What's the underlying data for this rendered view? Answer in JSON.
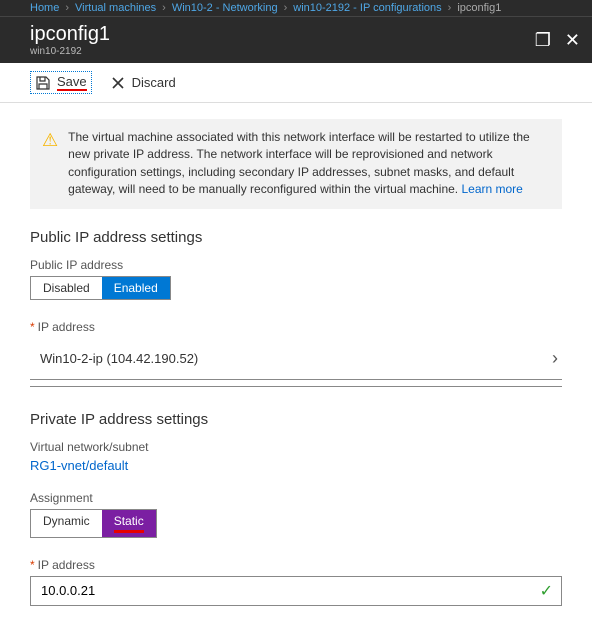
{
  "breadcrumb": {
    "items": [
      "Home",
      "Virtual machines",
      "Win10-2 - Networking",
      "win10-2192 - IP configurations"
    ],
    "current": "ipconfig1"
  },
  "header": {
    "title": "ipconfig1",
    "subtitle": "win10-2192"
  },
  "toolbar": {
    "save": "Save",
    "discard": "Discard"
  },
  "warning": {
    "text": "The virtual machine associated with this network interface will be restarted to utilize the new private IP address. The network interface will be reprovisioned and network configuration settings, including secondary IP addresses, subnet masks, and default gateway, will need to be manually reconfigured within the virtual machine.",
    "link": "Learn more"
  },
  "public_ip": {
    "heading": "Public IP address settings",
    "label": "Public IP address",
    "disabled": "Disabled",
    "enabled": "Enabled",
    "ip_label": "IP address",
    "ip_value": "Win10-2-ip (104.42.190.52)"
  },
  "private_ip": {
    "heading": "Private IP address settings",
    "subnet_label": "Virtual network/subnet",
    "subnet_value": "RG1-vnet/default",
    "assignment_label": "Assignment",
    "dynamic": "Dynamic",
    "static": "Static",
    "ip_label": "IP address",
    "ip_value": "10.0.0.21"
  }
}
